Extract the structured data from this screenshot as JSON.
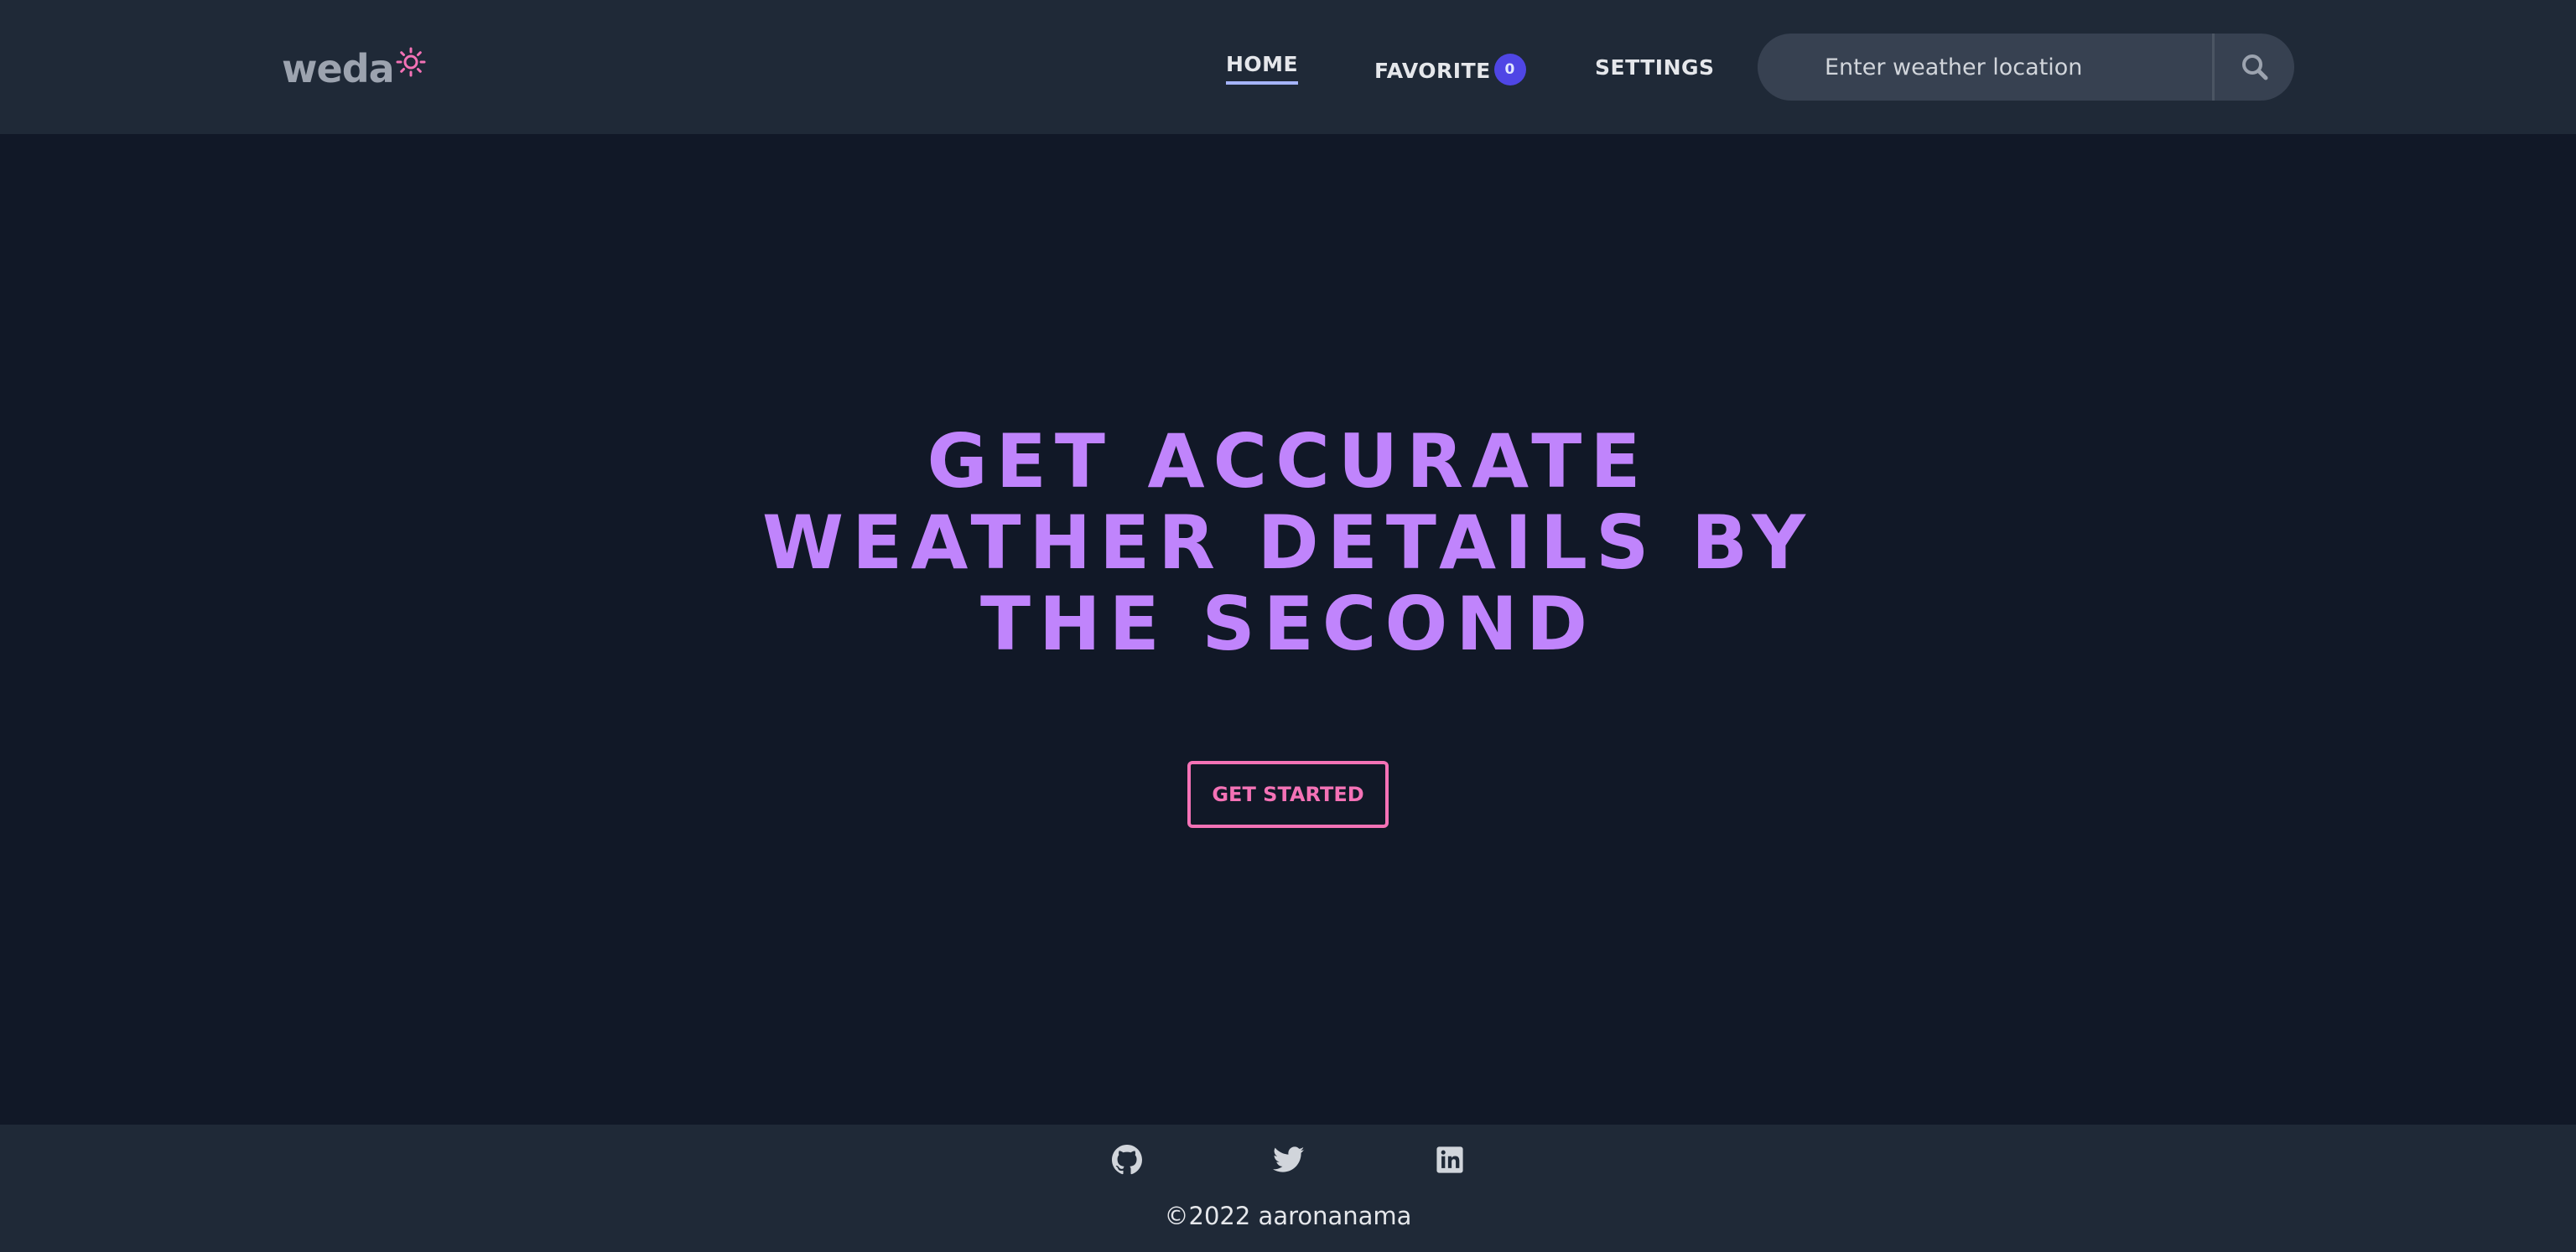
{
  "header": {
    "logo_text": "weda",
    "nav": {
      "home": "HOME",
      "favorite": "FAVORITE",
      "favorite_count": "0",
      "settings": "SETTINGS"
    },
    "search": {
      "placeholder": "Enter weather location",
      "icon": "search-icon"
    }
  },
  "hero": {
    "title_lines": [
      "GET ACCURATE",
      "WEATHER DETAILS BY",
      "THE SECOND"
    ],
    "cta_label": "GET STARTED"
  },
  "footer": {
    "social_icons": [
      "github-icon",
      "twitter-icon",
      "linkedin-icon"
    ],
    "copyright": "©2022 aaronanama"
  },
  "colors": {
    "background": "#111827",
    "header_bg": "#1f2937",
    "accent_purple": "#c084fc",
    "accent_pink": "#f472b6",
    "badge": "#4f46e5"
  }
}
